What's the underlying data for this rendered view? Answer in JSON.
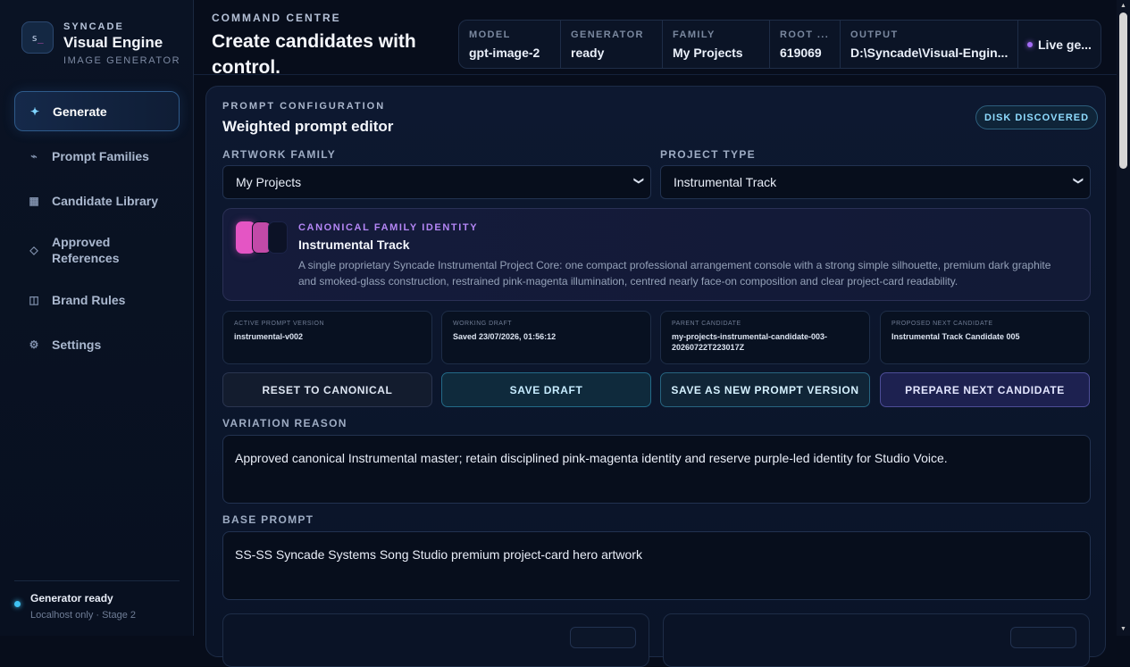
{
  "brand": {
    "kicker": "SYNCADE",
    "name": "Visual Engine",
    "subtitle": "IMAGE GENERATOR",
    "logo_text": "s",
    "logo_accent": "_"
  },
  "nav": [
    {
      "label": "Generate",
      "icon": "sparkle-icon",
      "glyph": "✦"
    },
    {
      "label": "Prompt Families",
      "icon": "trend-icon",
      "glyph": "⌁"
    },
    {
      "label": "Candidate Library",
      "icon": "grid-icon",
      "glyph": "▦"
    },
    {
      "label": "Approved References",
      "icon": "diamond-icon",
      "glyph": "◇"
    },
    {
      "label": "Brand Rules",
      "icon": "book-icon",
      "glyph": "◫"
    },
    {
      "label": "Settings",
      "icon": "gear-icon",
      "glyph": "⚙"
    }
  ],
  "status": {
    "title": "Generator ready",
    "subtitle": "Localhost only · Stage 2",
    "color": "#3fc3f3"
  },
  "header": {
    "kicker": "COMMAND CENTRE",
    "title": "Create candidates with control.",
    "stats": [
      {
        "key": "MODEL",
        "value": "gpt-image-2"
      },
      {
        "key": "GENERATOR",
        "value": "ready"
      },
      {
        "key": "FAMILY",
        "value": "My Projects"
      },
      {
        "key": "ROOT ...",
        "value": "619069"
      },
      {
        "key": "OUTPUT",
        "value": "D:\\Syncade\\Visual-Engin..."
      }
    ],
    "live": "Live ge..."
  },
  "panel": {
    "kicker": "PROMPT CONFIGURATION",
    "title": "Weighted prompt editor",
    "badge": "DISK DISCOVERED",
    "artwork_family_label": "ARTWORK FAMILY",
    "artwork_family_value": "My Projects",
    "project_type_label": "PROJECT TYPE",
    "project_type_value": "Instrumental Track",
    "identity": {
      "kicker": "CANONICAL FAMILY IDENTITY",
      "title": "Instrumental Track",
      "description": "A single proprietary Syncade Instrumental Project Core: one compact professional arrangement console with a strong simple silhouette, premium dark graphite and smoked-glass construction, restrained pink-magenta illumination, centred nearly face-on composition and clear project-card readability.",
      "swatches": [
        "#e455c4",
        "#c24aa8",
        "#0c1226"
      ]
    },
    "meta": [
      {
        "key": "ACTIVE PROMPT VERSION",
        "value": "instrumental-v002"
      },
      {
        "key": "WORKING DRAFT",
        "value": "Saved 23/07/2026, 01:56:12"
      },
      {
        "key": "PARENT CANDIDATE",
        "value": "my-projects-instrumental-candidate-003-20260722T223017Z"
      },
      {
        "key": "PROPOSED NEXT CANDIDATE",
        "value": "Instrumental Track Candidate 005"
      }
    ],
    "buttons": {
      "reset": "RESET TO CANONICAL",
      "save_draft": "SAVE DRAFT",
      "save_version": "SAVE AS NEW PROMPT VERSION",
      "prepare": "PREPARE NEXT CANDIDATE"
    },
    "variation_label": "VARIATION REASON",
    "variation_value": "Approved canonical Instrumental master; retain disciplined pink-magenta identity and reserve purple-led identity for Studio Voice.",
    "base_label": "BASE PROMPT",
    "base_value": "SS-SS Syncade Systems Song Studio premium project-card hero artwork"
  }
}
